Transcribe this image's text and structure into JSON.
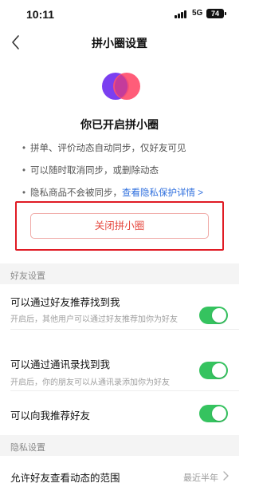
{
  "status_bar": {
    "time": "10:11",
    "network": "5G",
    "battery": "74",
    "signal_icon": "cellular-signal-icon"
  },
  "nav": {
    "title": "拼小圈设置",
    "back_icon": "chevron-left-icon"
  },
  "hero": {
    "logo_icon": "pinxiaoquan-logo-icon",
    "title": "你已开启拼小圈",
    "items": [
      {
        "bullet": "•",
        "text": "拼单、评价动态自动同步，仅好友可见"
      },
      {
        "bullet": "•",
        "text": "可以随时取消同步，或删除动态"
      },
      {
        "bullet": "•",
        "text": "隐私商品不会被同步，",
        "link": "查看隐私保护详情 >"
      }
    ]
  },
  "close_button": {
    "label": "关闭拼小圈",
    "color": "#e5473d"
  },
  "friend_settings": {
    "header": "好友设置",
    "rows": [
      {
        "title": "可以通过好友推荐找到我",
        "desc": "开启后，其他用户可以通过好友推荐加你为好友",
        "enabled": true
      },
      {
        "title": "可以通过通讯录找到我",
        "desc": "开启后，你的朋友可以从通讯录添加你为好友",
        "enabled": true
      },
      {
        "title": "可以向我推荐好友",
        "enabled": true
      }
    ]
  },
  "privacy_settings": {
    "header": "隐私设置",
    "rows": [
      {
        "title": "允许好友查看动态的范围",
        "value": "最近半年",
        "icon": "chevron-right-icon"
      }
    ]
  },
  "colors": {
    "toggle_on": "#35c35f",
    "link": "#2f6fde",
    "highlight_border": "#e01b24",
    "section_bg": "#f4f4f4"
  }
}
